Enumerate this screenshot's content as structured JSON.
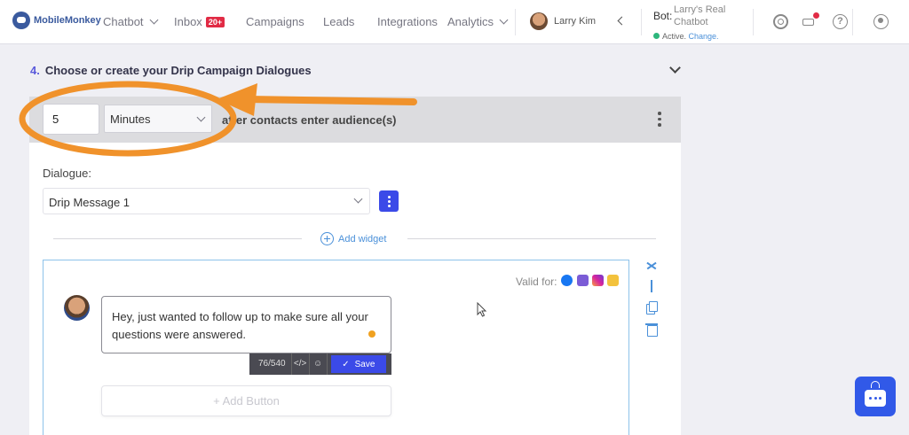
{
  "nav": {
    "brand": "MobileMonkey",
    "items": [
      {
        "label": "Chatbot",
        "dropdown": true
      },
      {
        "label": "Inbox",
        "badge": "20+"
      },
      {
        "label": "Campaigns"
      },
      {
        "label": "Leads"
      },
      {
        "label": "Integrations"
      },
      {
        "label": "Analytics",
        "dropdown": true
      }
    ],
    "user_name": "Larry Kim",
    "bot_label": "Bot:",
    "bot_name": "Larry's Real Chatbot",
    "bot_status": "Active.",
    "bot_change": "Change.",
    "icons": [
      "settings-gear-icon",
      "megaphone-icon",
      "help-icon",
      "profile-icon"
    ]
  },
  "section": {
    "number": "4.",
    "title": "Choose or create your Drip Campaign Dialogues"
  },
  "drip": {
    "delay_value": "5",
    "delay_unit": "Minutes",
    "after_text": "after contacts enter audience(s)"
  },
  "dialogue": {
    "label": "Dialogue:",
    "selected": "Drip Message 1",
    "add_widget": "Add widget"
  },
  "widget": {
    "valid_for": "Valid for:",
    "channels": [
      "messenger-icon",
      "sms-icon",
      "instagram-icon",
      "web-chat-icon"
    ],
    "message": "Hey, just wanted to follow up to make sure all your questions were answered.",
    "char_count": "76/540",
    "code_glyph": "</>",
    "save_label": "Save",
    "add_button": "+ Add Button"
  },
  "colors": {
    "accent": "#3b4ae8",
    "link": "#4a90d9",
    "annotation": "#f0922b",
    "status_active": "#2db67c",
    "badge": "#e12b45"
  }
}
